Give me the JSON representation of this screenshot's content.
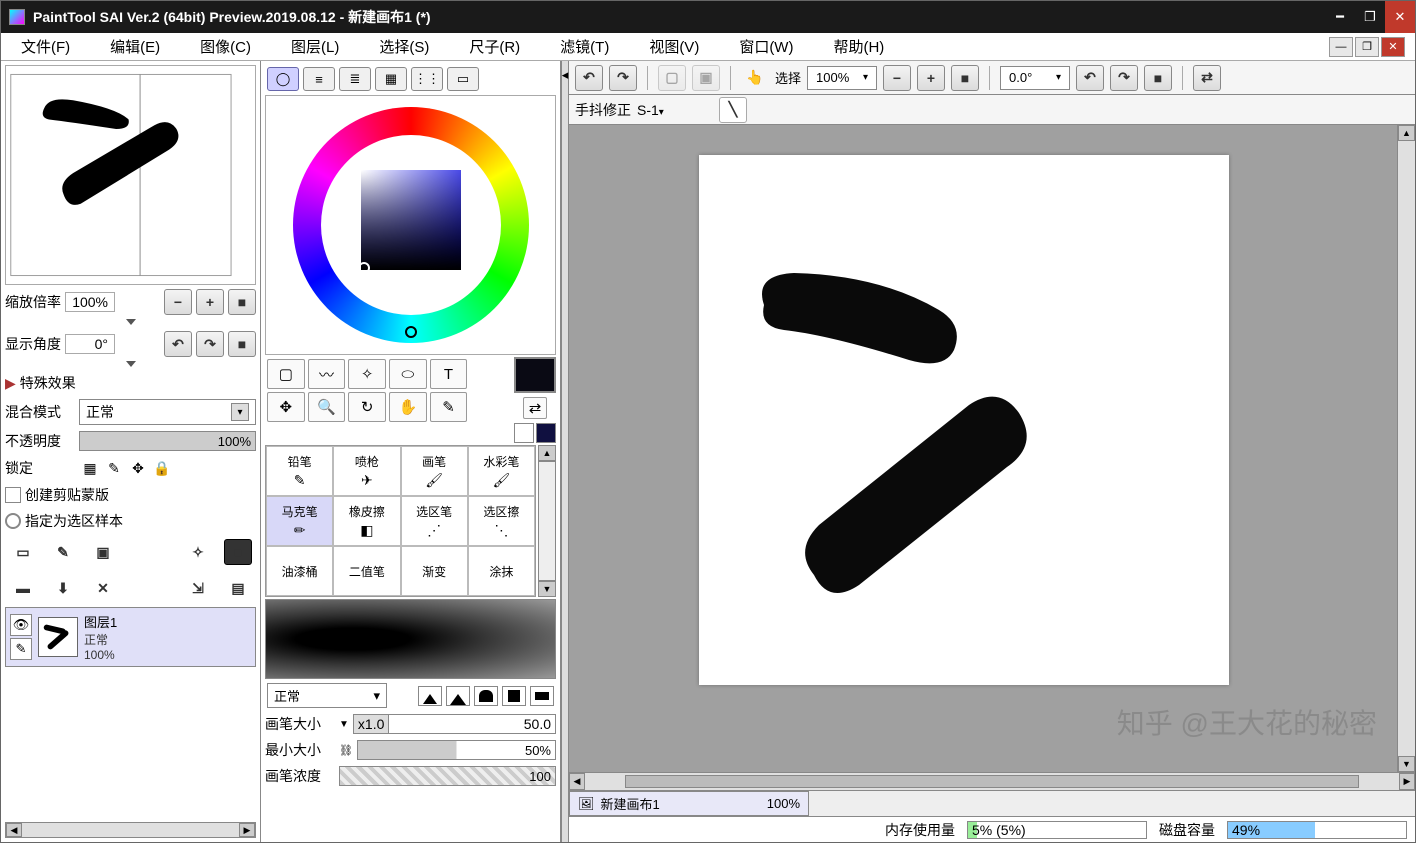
{
  "title": "PaintTool SAI Ver.2 (64bit) Preview.2019.08.12 - 新建画布1 (*)",
  "menu": {
    "file": "文件(F)",
    "edit": "编辑(E)",
    "image": "图像(C)",
    "layer": "图层(L)",
    "select": "选择(S)",
    "ruler": "尺子(R)",
    "filter": "滤镜(T)",
    "view": "视图(V)",
    "window": "窗口(W)",
    "help": "帮助(H)"
  },
  "nav": {
    "zoom_label": "缩放倍率",
    "zoom_value": "100%",
    "angle_label": "显示角度",
    "angle_value": "0°"
  },
  "effects": {
    "header": "特殊效果",
    "blend_label": "混合模式",
    "blend_value": "正常",
    "opacity_label": "不透明度",
    "opacity_value": "100%",
    "lock_label": "锁定",
    "clipmask": "创建剪贴蒙版",
    "selsample": "指定为选区样本"
  },
  "layer": {
    "name": "图层1",
    "mode": "正常",
    "opacity": "100%"
  },
  "tools": {
    "brushes": [
      "铅笔",
      "喷枪",
      "画笔",
      "水彩笔",
      "马克笔",
      "橡皮擦",
      "选区笔",
      "选区擦",
      "油漆桶",
      "二值笔",
      "渐变",
      "涂抹"
    ],
    "sel_index": 4
  },
  "brushopts": {
    "mode": "正常",
    "size_label": "画笔大小",
    "size_mult": "x1.0",
    "size_value": "50.0",
    "min_label": "最小大小",
    "min_value": "50%",
    "density_label": "画笔浓度",
    "density_value": "100"
  },
  "top": {
    "select_label": "选择",
    "zoom": "100%",
    "angle": "0.0°",
    "stab_label": "手抖修正",
    "stab_value": "S-1"
  },
  "doc": {
    "name": "新建画布1",
    "pct": "100%"
  },
  "status": {
    "mem_label": "内存使用量",
    "mem_value": "5% (5%)",
    "disk_label": "磁盘容量",
    "disk_value": "49%"
  },
  "watermark": "知乎 @王大花的秘密"
}
